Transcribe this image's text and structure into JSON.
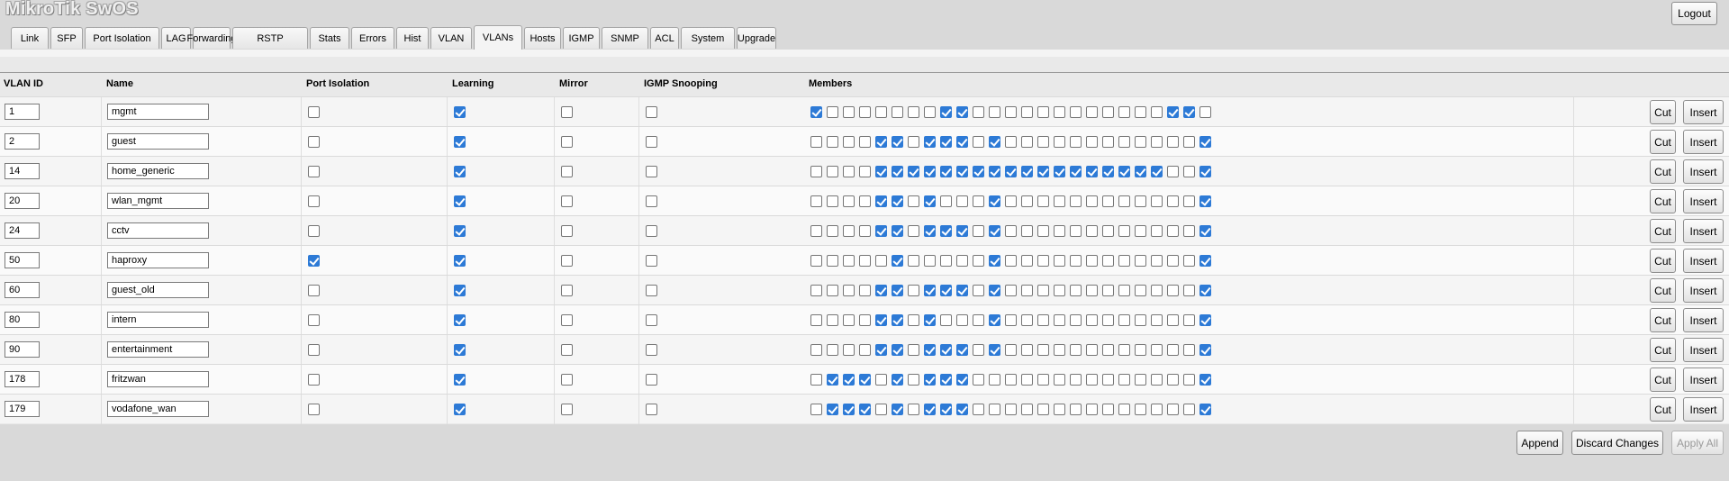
{
  "app": {
    "title": "MikroTik SwOS",
    "logout_label": "Logout"
  },
  "tabs": [
    {
      "label": "Link",
      "active": false
    },
    {
      "label": "SFP",
      "active": false
    },
    {
      "label": "Port Isolation",
      "active": false
    },
    {
      "label": "LAG",
      "active": false
    },
    {
      "label": "Forwarding",
      "active": false
    },
    {
      "label": "RSTP",
      "active": false
    },
    {
      "label": "Stats",
      "active": false
    },
    {
      "label": "Errors",
      "active": false
    },
    {
      "label": "Hist",
      "active": false
    },
    {
      "label": "VLAN",
      "active": false
    },
    {
      "label": "VLANs",
      "active": true
    },
    {
      "label": "Hosts",
      "active": false
    },
    {
      "label": "IGMP",
      "active": false
    },
    {
      "label": "SNMP",
      "active": false
    },
    {
      "label": "ACL",
      "active": false
    },
    {
      "label": "System",
      "active": false
    },
    {
      "label": "Upgrade",
      "active": false
    }
  ],
  "table": {
    "headers": {
      "vlan_id": "VLAN ID",
      "name": "Name",
      "port_isolation": "Port Isolation",
      "learning": "Learning",
      "mirror": "Mirror",
      "igmp_snooping": "IGMP Snooping",
      "members": "Members"
    },
    "cut_label": "Cut",
    "insert_label": "Insert",
    "rows": [
      {
        "vlan_id": "1",
        "name": "mgmt",
        "port_isolation": false,
        "learning": true,
        "mirror": false,
        "igmp_snooping": false,
        "members": "1000000011000000000000110"
      },
      {
        "vlan_id": "2",
        "name": "guest",
        "port_isolation": false,
        "learning": true,
        "mirror": false,
        "igmp_snooping": false,
        "members": "0000110111010000000000001"
      },
      {
        "vlan_id": "14",
        "name": "home_generic",
        "port_isolation": false,
        "learning": true,
        "mirror": false,
        "igmp_snooping": false,
        "members": "0000111111111111111111001"
      },
      {
        "vlan_id": "20",
        "name": "wlan_mgmt",
        "port_isolation": false,
        "learning": true,
        "mirror": false,
        "igmp_snooping": false,
        "members": "0000110100010000000000001"
      },
      {
        "vlan_id": "24",
        "name": "cctv",
        "port_isolation": false,
        "learning": true,
        "mirror": false,
        "igmp_snooping": false,
        "members": "0000110111010000000000001"
      },
      {
        "vlan_id": "50",
        "name": "haproxy",
        "port_isolation": true,
        "learning": true,
        "mirror": false,
        "igmp_snooping": false,
        "members": "0000010000010000000000001"
      },
      {
        "vlan_id": "60",
        "name": "guest_old",
        "port_isolation": false,
        "learning": true,
        "mirror": false,
        "igmp_snooping": false,
        "members": "0000110111010000000000001"
      },
      {
        "vlan_id": "80",
        "name": "intern",
        "port_isolation": false,
        "learning": true,
        "mirror": false,
        "igmp_snooping": false,
        "members": "0000110100010000000000001"
      },
      {
        "vlan_id": "90",
        "name": "entertainment",
        "port_isolation": false,
        "learning": true,
        "mirror": false,
        "igmp_snooping": false,
        "members": "0000110111010000000000001"
      },
      {
        "vlan_id": "178",
        "name": "fritzwan",
        "port_isolation": false,
        "learning": true,
        "mirror": false,
        "igmp_snooping": false,
        "members": "0111010111000000000000001"
      },
      {
        "vlan_id": "179",
        "name": "vodafone_wan",
        "port_isolation": false,
        "learning": true,
        "mirror": false,
        "igmp_snooping": false,
        "members": "0111010111000000000000001"
      }
    ]
  },
  "footer": {
    "append_label": "Append",
    "discard_label": "Discard Changes",
    "apply_label": "Apply All",
    "apply_enabled": false
  }
}
